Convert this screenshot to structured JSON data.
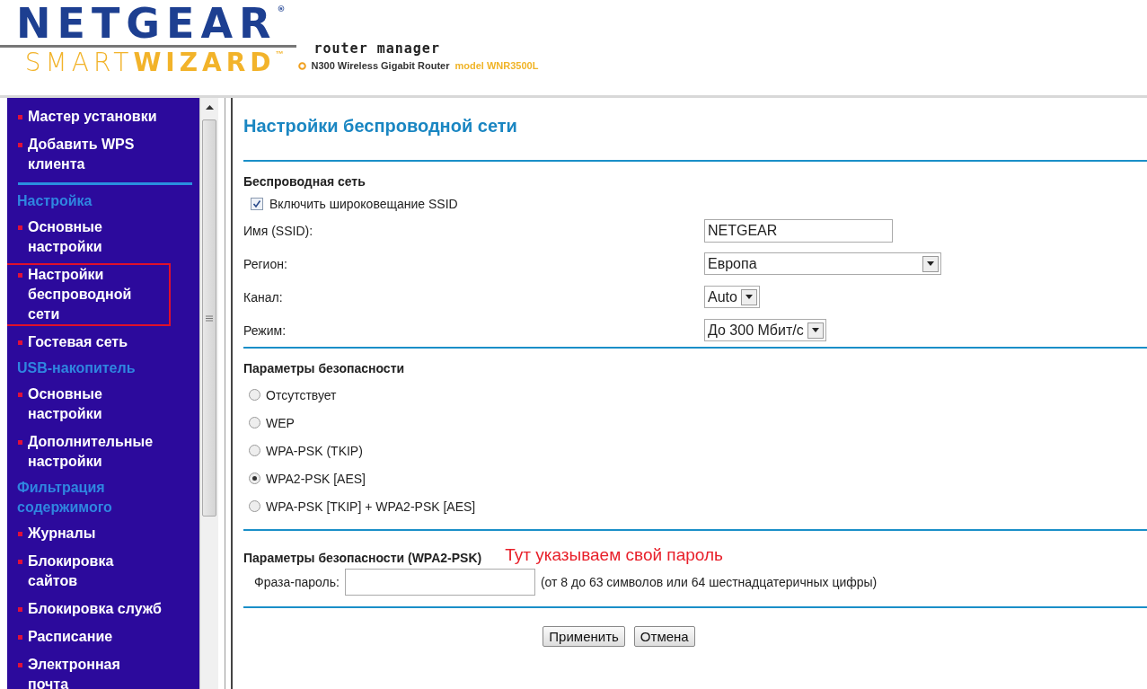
{
  "header": {
    "brand": "NETGEAR",
    "brand_mark": "®",
    "smart": "SMART",
    "wizard": "WIZARD",
    "trademark": "™",
    "subtitle": "router manager",
    "product": "N300 Wireless Gigabit Router",
    "model": "model WNR3500L"
  },
  "sidebar": {
    "items": [
      {
        "kind": "link",
        "label": "Мастер установки",
        "outlined": false
      },
      {
        "kind": "link",
        "label": "Добавить WPS клиента",
        "outlined": false
      },
      {
        "kind": "divider"
      },
      {
        "kind": "heading",
        "label": "Настройка"
      },
      {
        "kind": "link",
        "label": "Основные настройки",
        "outlined": false
      },
      {
        "kind": "link",
        "label": "Настройки беспроводной сети",
        "outlined": true
      },
      {
        "kind": "link",
        "label": "Гостевая сеть",
        "outlined": false
      },
      {
        "kind": "heading",
        "label": "USB-накопитель"
      },
      {
        "kind": "link",
        "label": "Основные настройки",
        "outlined": false
      },
      {
        "kind": "link",
        "label": "Дополнительные настройки",
        "outlined": false
      },
      {
        "kind": "heading",
        "label": "Фильтрация содержимого"
      },
      {
        "kind": "link",
        "label": "Журналы",
        "outlined": false
      },
      {
        "kind": "link",
        "label": "Блокировка сайтов",
        "outlined": false
      },
      {
        "kind": "link",
        "label": "Блокировка служб",
        "outlined": false
      },
      {
        "kind": "link",
        "label": "Расписание",
        "outlined": false
      },
      {
        "kind": "link",
        "label": "Электронная почта",
        "outlined": false
      }
    ]
  },
  "page": {
    "title": "Настройки беспроводной сети",
    "wireless": {
      "heading": "Беспроводная сеть",
      "broadcast": {
        "label": "Включить широковещание SSID",
        "checked": true
      },
      "fields": [
        {
          "kind": "text",
          "label": "Имя (SSID):",
          "value": "NETGEAR"
        },
        {
          "kind": "select",
          "label": "Регион:",
          "value": "Европа"
        },
        {
          "kind": "select",
          "label": "Канал:",
          "value": "Auto"
        },
        {
          "kind": "select",
          "label": "Режим:",
          "value": "До 300 Мбит/с"
        }
      ]
    },
    "security": {
      "heading": "Параметры безопасности",
      "options": [
        {
          "label": "Отсутствует",
          "selected": false
        },
        {
          "label": "WEP",
          "selected": false
        },
        {
          "label": "WPA-PSK (TKIP)",
          "selected": false
        },
        {
          "label": "WPA2-PSK [AES]",
          "selected": true
        },
        {
          "label": "WPA-PSK [TKIP] + WPA2-PSK [AES]",
          "selected": false
        }
      ]
    },
    "passphrase": {
      "heading": "Параметры безопасности (WPA2-PSK)",
      "annotation": "Тут указываем свой пароль",
      "label": "Фраза-пароль:",
      "hint": "(от 8 до 63 символов или 64 шестнадцатеричных цифры)"
    },
    "buttons": [
      "Применить",
      "Отмена"
    ]
  }
}
